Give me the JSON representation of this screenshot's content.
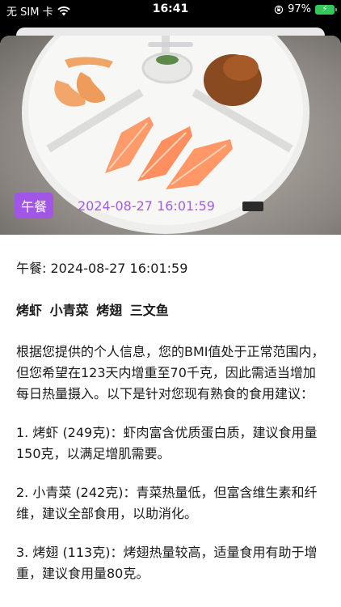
{
  "status": {
    "carrier": "无 SIM 卡",
    "time": "16:41",
    "battery": "97%"
  },
  "photo": {
    "meal_tag": "午餐",
    "timestamp": "2024-08-27 16:01:59"
  },
  "content": {
    "header": "午餐: 2024-08-27 16:01:59",
    "foods": [
      "烤虾",
      "小青菜",
      "烤翅",
      "三文鱼"
    ],
    "paragraphs": [
      "根据您提供的个人信息，您的BMI值处于正常范围内，但您希望在123天内增重至70千克，因此需适当增加每日热量摄入。以下是针对您现有熟食的食用建议：",
      "1. 烤虾 (249克)：虾肉富含优质蛋白质，建议食用量150克，以满足增肌需要。",
      "2. 小青菜 (242克)：青菜热量低，但富含维生素和纤维，建议全部食用，以助消化。",
      "3. 烤翅 (113克)：烤翅热量较高，适量食用有助于增重，建议食用量80克。"
    ]
  },
  "colors": {
    "accent": "#a156e6",
    "timestamp_overlay": "#a35ce4",
    "battery": "#34c759"
  },
  "icons": [
    "wifi-icon",
    "screen-rotation-lock-icon",
    "battery-icon"
  ]
}
